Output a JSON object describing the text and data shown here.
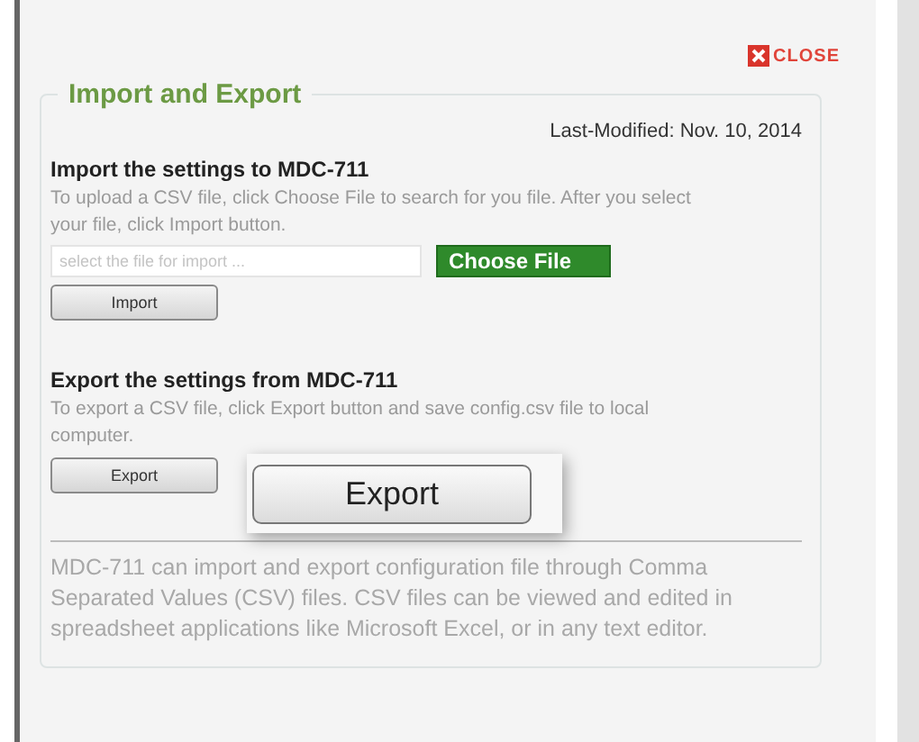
{
  "close": {
    "label": "CLOSE"
  },
  "legend": "Import and Export",
  "last_modified": "Last-Modified: Nov. 10, 2014",
  "import": {
    "heading": "Import the settings to MDC-711",
    "description": "To upload a CSV file, click Choose File to search for you file. After you select your file, click Import button.",
    "file_field": {
      "placeholder": "select the file for import ..."
    },
    "choose_button": "Choose File",
    "import_button": "Import"
  },
  "export": {
    "heading": "Export the settings from MDC-711",
    "description": "To export a CSV file, click Export button and save config.csv file to local computer.",
    "export_button": "Export",
    "callout_button": "Export"
  },
  "note": "MDC-711 can import and export configuration file through Comma Separated Values (CSV) files. CSV files can be viewed and edited in spreadsheet applications like Microsoft Excel, or in any text editor."
}
